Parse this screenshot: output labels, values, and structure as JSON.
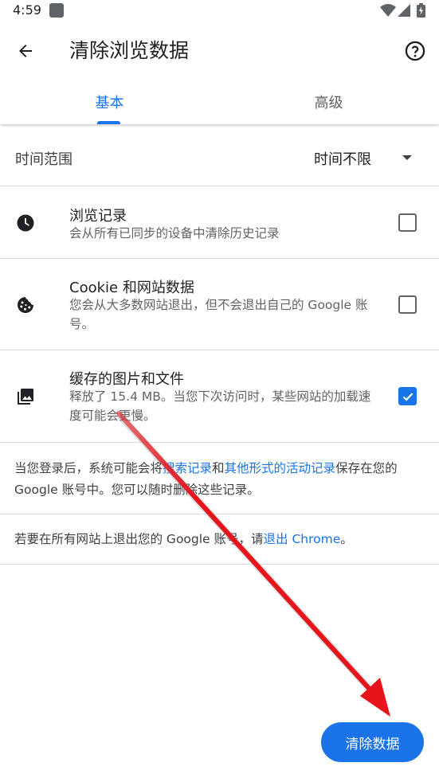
{
  "status_bar": {
    "time": "4:59"
  },
  "app_bar": {
    "title": "清除浏览数据"
  },
  "tabs": [
    {
      "label": "基本",
      "selected": true
    },
    {
      "label": "高级",
      "selected": false
    }
  ],
  "time_range": {
    "label": "时间范围",
    "value": "时间不限"
  },
  "options": [
    {
      "icon": "clock-icon",
      "title": "浏览记录",
      "description": "会从所有已同步的设备中清除历史记录",
      "checked": false
    },
    {
      "icon": "cookie-icon",
      "title": "Cookie 和网站数据",
      "description": "您会从大多数网站退出，但不会退出自己的 Google 账号。",
      "checked": false
    },
    {
      "icon": "image-icon",
      "title": "缓存的图片和文件",
      "description": "释放了 15.4 MB。当您下次访问时，某些网站的加载速度可能会更慢。",
      "checked": true
    }
  ],
  "info": {
    "part1": "当您登录后，系统可能会将",
    "link1": "搜索记录",
    "part2": "和",
    "link2": "其他形式的活动记录",
    "part3": "保存在您的 Google 账号中。您可以随时删除这些记录。"
  },
  "signout": {
    "prefix": "若要在所有网站上退出您的 Google 账号，请",
    "link": "退出 Chrome",
    "suffix": "。"
  },
  "clear_button": {
    "label": "清除数据"
  },
  "colors": {
    "accent": "#1a73e8",
    "annotation": "#e8141b"
  }
}
